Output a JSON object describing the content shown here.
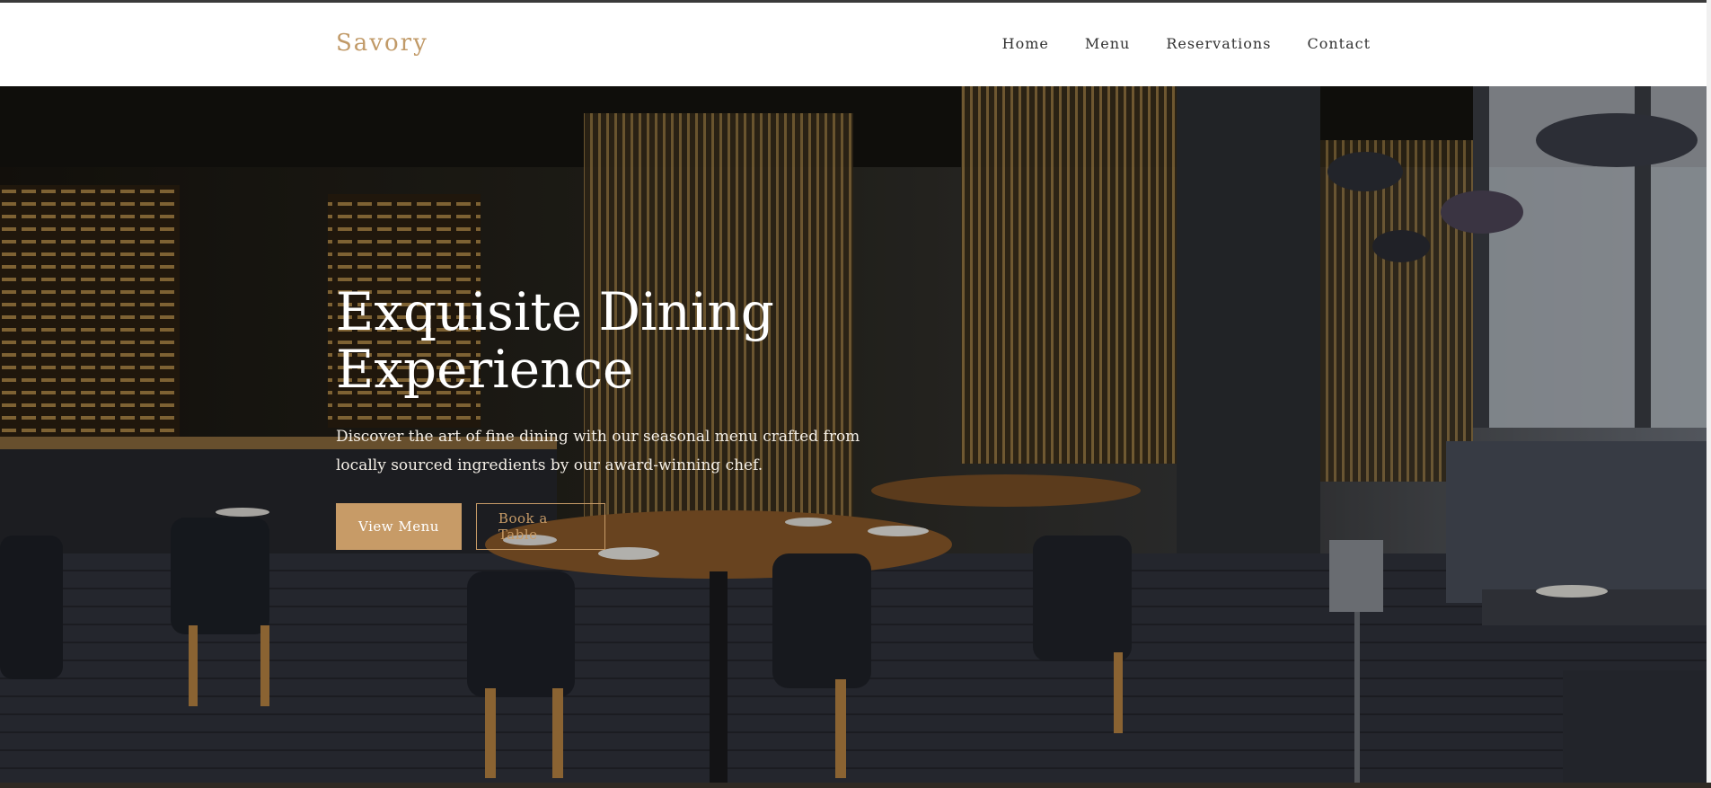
{
  "brand": {
    "name": "Savory"
  },
  "nav": {
    "items": [
      {
        "label": "Home"
      },
      {
        "label": "Menu"
      },
      {
        "label": "Reservations"
      },
      {
        "label": "Contact"
      }
    ]
  },
  "hero": {
    "title": "Exquisite Dining Experience",
    "text": "Discover the art of fine dining with our seasonal menu crafted from locally sourced ingredients by our award-winning chef.",
    "primary_button": "View Menu",
    "secondary_button": "Book a Table"
  },
  "colors": {
    "accent": "#c79b67",
    "header_bg": "#ffffff",
    "nav_text": "#333333"
  }
}
